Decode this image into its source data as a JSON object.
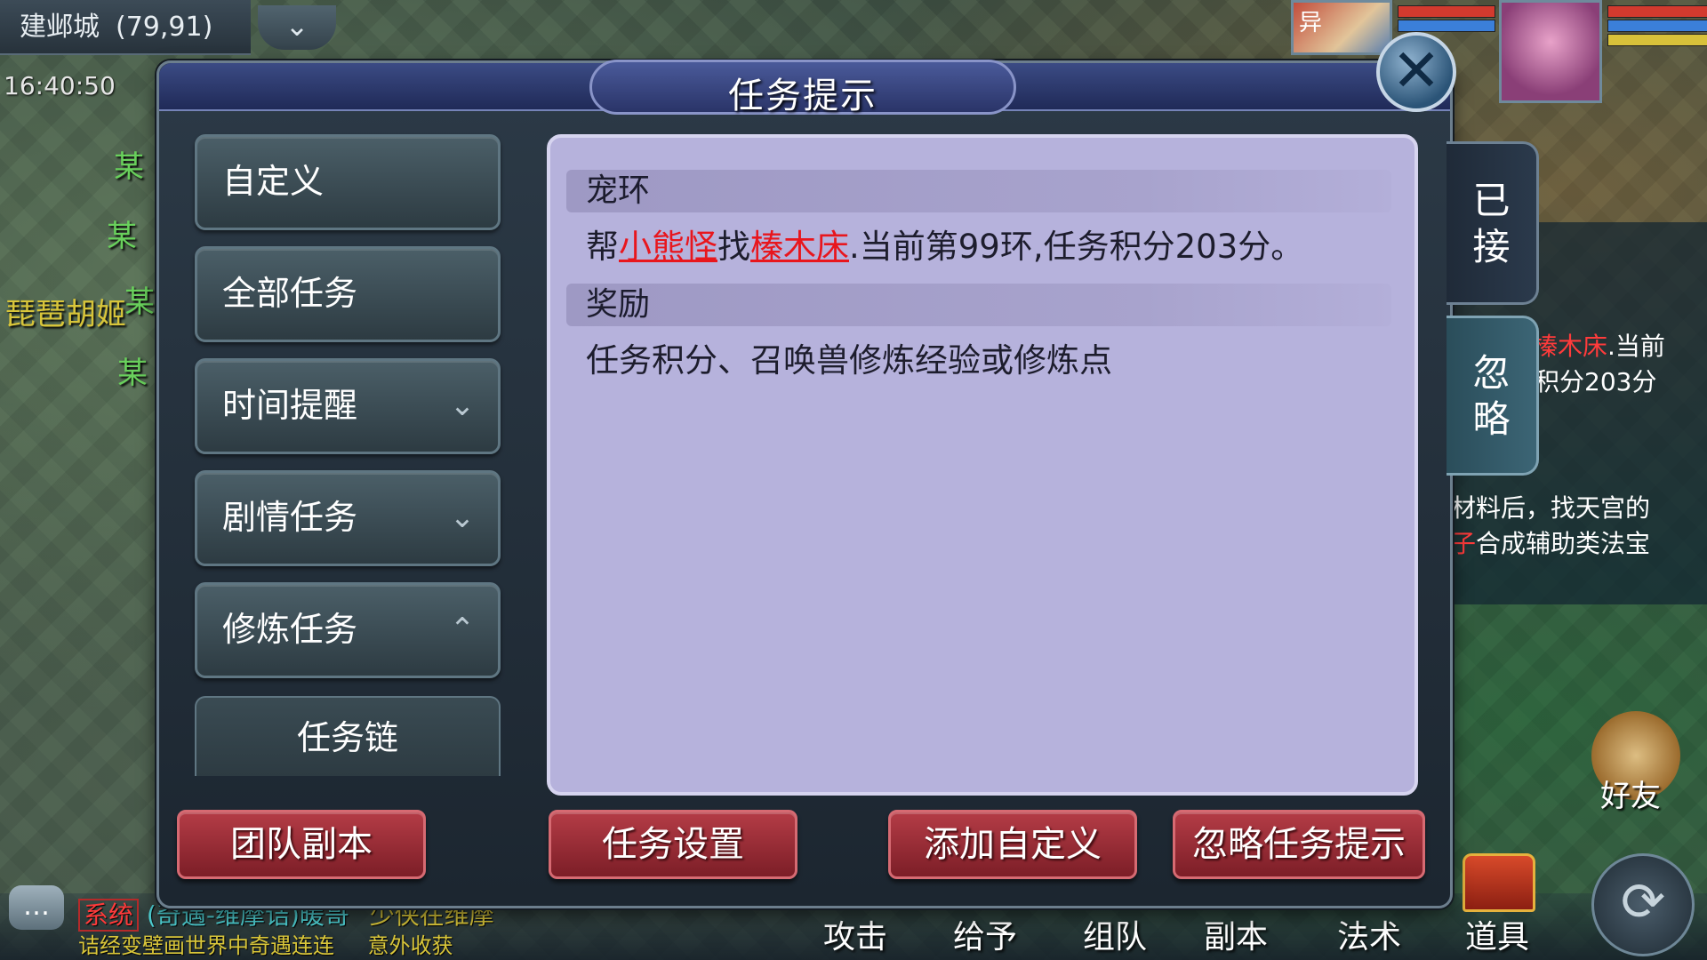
{
  "hud": {
    "map_name": "建邺城",
    "coords": "(79,91)",
    "clock": "16:40:50",
    "portrait_tag": "异",
    "npc_labels": [
      "某",
      "某",
      "某",
      "某"
    ],
    "npc_special": "琵琶胡姬",
    "side_panel": {
      "line1_red": "榛木床",
      "line1_rest": ".当前",
      "line2": "积分203分",
      "line3": "材料后，找天宫的",
      "line4_red": "子",
      "line4_rest": "合成辅助类法宝"
    },
    "friend_label": "好友",
    "chat": {
      "channel": "系统",
      "line1_a": "(奇遇-维摩诘)暖哥",
      "line1_b": "少侠在维摩",
      "line2": "诘经变壁画世界中奇遇连连",
      "line2_b": "意外收获"
    },
    "actions": [
      "攻击",
      "给予",
      "组队",
      "副本",
      "法术",
      "道具"
    ]
  },
  "dialog": {
    "title": "任务提示",
    "close_symbol": "✕",
    "categories": [
      {
        "label": "自定义",
        "chevron": ""
      },
      {
        "label": "全部任务",
        "chevron": ""
      },
      {
        "label": "时间提醒",
        "chevron": "⌄"
      },
      {
        "label": "剧情任务",
        "chevron": "⌄"
      },
      {
        "label": "修炼任务",
        "chevron": "⌃"
      }
    ],
    "sub_item": "任务链",
    "detail": {
      "task_title": "宠环",
      "task_text": {
        "prefix": "帮",
        "npc": "小熊怪",
        "mid": "找",
        "item": "榛木床",
        "suffix": ".当前第99环,任务积分203分。"
      },
      "reward_title": "奖励",
      "reward_text": "任务积分、召唤兽修炼经验或修炼点"
    },
    "tabs": {
      "accepted": "已\n接",
      "accepted_l1": "已",
      "accepted_l2": "接",
      "ignored_l1": "忽",
      "ignored_l2": "略"
    },
    "buttons": {
      "team_dungeon": "团队副本",
      "task_settings": "任务设置",
      "add_custom": "添加自定义",
      "ignore_hint": "忽略任务提示"
    }
  }
}
